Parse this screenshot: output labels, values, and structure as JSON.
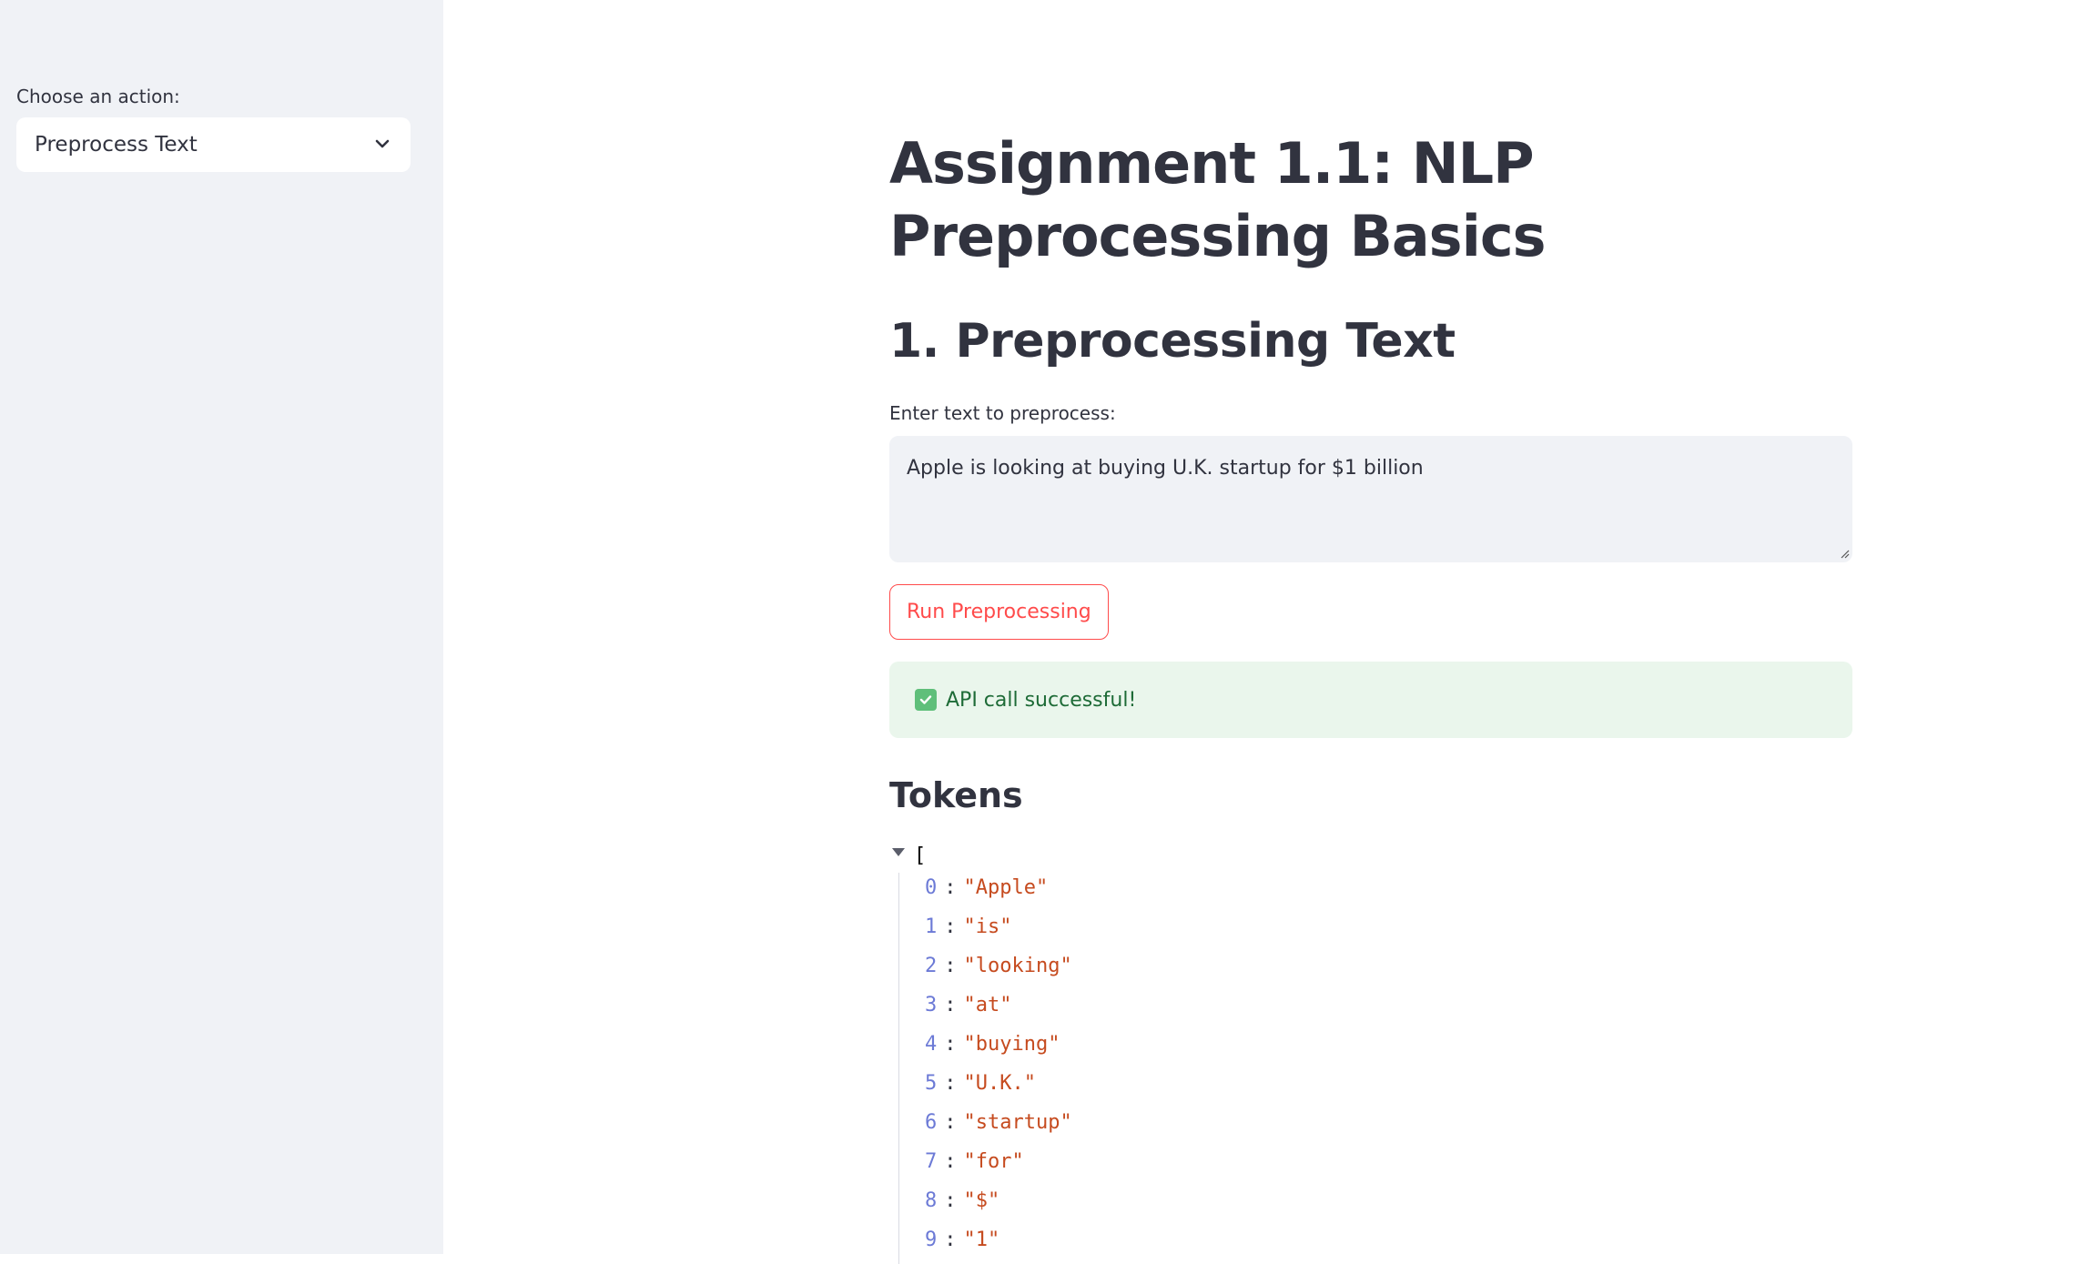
{
  "sidebar": {
    "label": "Choose an action:",
    "selected": "Preprocess Text"
  },
  "main": {
    "title": "Assignment 1.1: NLP Preprocessing Basics",
    "section_title": "1. Preprocessing Text",
    "input_label": "Enter text to preprocess:",
    "input_value": "Apple is looking at buying U.K. startup for $1 billion",
    "run_button": "Run Preprocessing",
    "alert_text": "API call successful!",
    "tokens_title": "Tokens",
    "open_bracket": "[",
    "tokens": [
      {
        "index": "0",
        "value": "\"Apple\""
      },
      {
        "index": "1",
        "value": "\"is\""
      },
      {
        "index": "2",
        "value": "\"looking\""
      },
      {
        "index": "3",
        "value": "\"at\""
      },
      {
        "index": "4",
        "value": "\"buying\""
      },
      {
        "index": "5",
        "value": "\"U.K.\""
      },
      {
        "index": "6",
        "value": "\"startup\""
      },
      {
        "index": "7",
        "value": "\"for\""
      },
      {
        "index": "8",
        "value": "\"$\""
      },
      {
        "index": "9",
        "value": "\"1\""
      }
    ]
  },
  "colors": {
    "accent": "#ff4b4b",
    "sidebar_bg": "#f0f2f6",
    "success_bg": "#eaf6ec",
    "success_text": "#1e6b37",
    "json_index": "#6c7ad6",
    "json_string": "#c64b1f"
  },
  "icons": {
    "select_chevron": "chevron-down-icon",
    "alert": "check-box-icon",
    "json_toggle": "caret-down-icon"
  }
}
